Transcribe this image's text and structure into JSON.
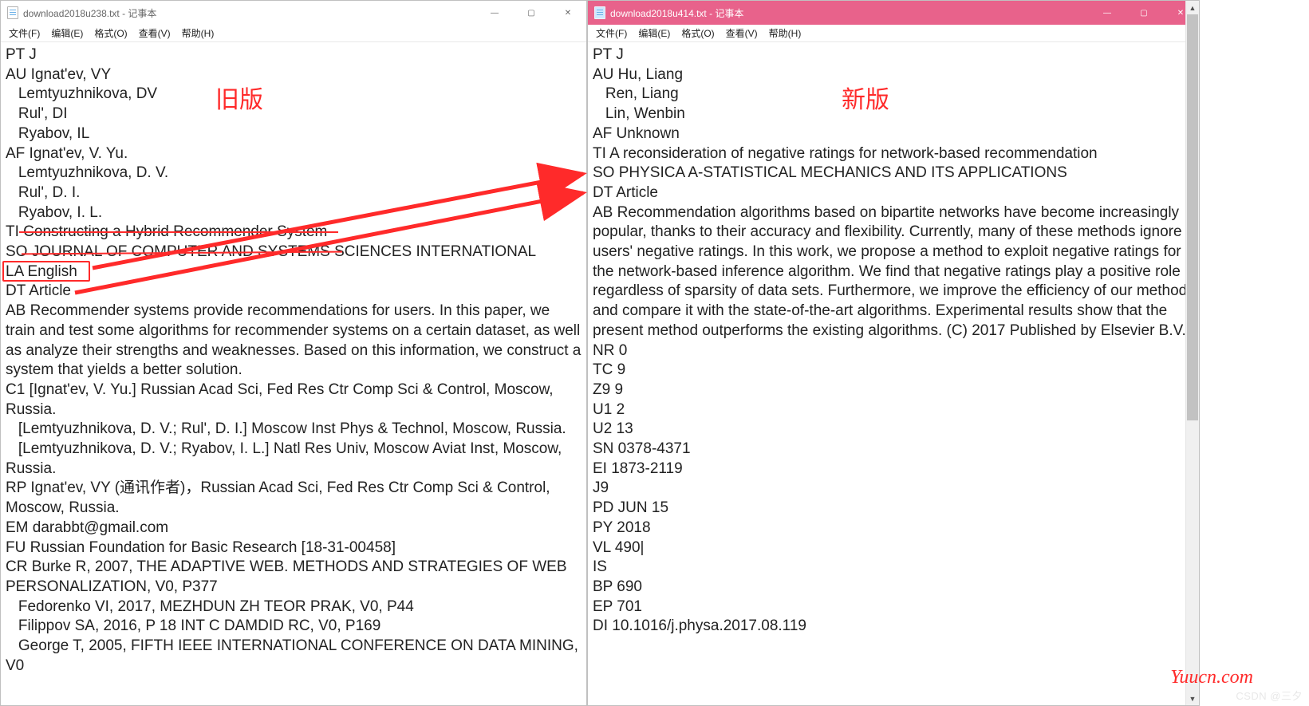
{
  "left": {
    "title": "download2018u238.txt - 记事本",
    "menu": [
      "文件(F)",
      "编辑(E)",
      "格式(O)",
      "查看(V)",
      "帮助(H)"
    ],
    "text": "PT J\nAU Ignat'ev, VY\n   Lemtyuzhnikova, DV\n   Rul', DI\n   Ryabov, IL\nAF Ignat'ev, V. Yu.\n   Lemtyuzhnikova, D. V.\n   Rul', D. I.\n   Ryabov, I. L.\nTI Constructing a Hybrid Recommender System\nSO JOURNAL OF COMPUTER AND SYSTEMS SCIENCES INTERNATIONAL\nLA English\nDT Article\nAB Recommender systems provide recommendations for users. In this paper, we train and test some algorithms for recommender systems on a certain dataset, as well as analyze their strengths and weaknesses. Based on this information, we construct a system that yields a better solution.\nC1 [Ignat'ev, V. Yu.] Russian Acad Sci, Fed Res Ctr Comp Sci & Control, Moscow, Russia.\n   [Lemtyuzhnikova, D. V.; Rul', D. I.] Moscow Inst Phys & Technol, Moscow, Russia.\n   [Lemtyuzhnikova, D. V.; Ryabov, I. L.] Natl Res Univ, Moscow Aviat Inst, Moscow, Russia.\nRP Ignat'ev, VY (通讯作者)，Russian Acad Sci, Fed Res Ctr Comp Sci & Control, Moscow, Russia.\nEM darabbt@gmail.com\nFU Russian Foundation for Basic Research [18-31-00458]\nCR Burke R, 2007, THE ADAPTIVE WEB. METHODS AND STRATEGIES OF WEB PERSONALIZATION, V0, P377\n   Fedorenko VI, 2017, MEZHDUN ZH TEOR PRAK, V0, P44\n   Filippov SA, 2016, P 18 INT C DAMDID RC, V0, P169\n   George T, 2005, FIFTH IEEE INTERNATIONAL CONFERENCE ON DATA MINING, V0"
  },
  "right": {
    "title": "download2018u414.txt - 记事本",
    "menu": [
      "文件(F)",
      "编辑(E)",
      "格式(O)",
      "查看(V)",
      "帮助(H)"
    ],
    "text": "PT J\nAU Hu, Liang\n   Ren, Liang\n   Lin, Wenbin\nAF Unknown\nTI A reconsideration of negative ratings for network-based recommendation\nSO PHYSICA A-STATISTICAL MECHANICS AND ITS APPLICATIONS\nDT Article\nAB Recommendation algorithms based on bipartite networks have become increasingly popular, thanks to their accuracy and flexibility. Currently, many of these methods ignore users' negative ratings. In this work, we propose a method to exploit negative ratings for the network-based inference algorithm. We find that negative ratings play a positive role regardless of sparsity of data sets. Furthermore, we improve the efficiency of our method and compare it with the state-of-the-art algorithms. Experimental results show that the present method outperforms the existing algorithms. (C) 2017 Published by Elsevier B.V.\nNR 0\nTC 9\nZ9 9\nU1 2\nU2 13\nSN 0378-4371\nEI 1873-2119\nJ9\nPD JUN 15\nPY 2018\nVL 490|\nIS\nBP 690\nEP 701\nDI 10.1016/j.physa.2017.08.119"
  },
  "annotations": {
    "old_label": "旧版",
    "new_label": "新版"
  },
  "branding": {
    "yuucn": "Yuucn.com",
    "csdn": "CSDN @三夕"
  }
}
